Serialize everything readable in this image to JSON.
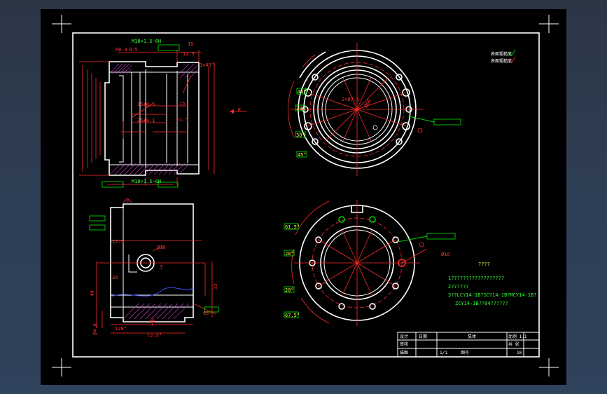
{
  "drawing": {
    "callouts": {
      "thread_top": "M18×1.5-6H",
      "thread_bottom": "M18×1.5-6H",
      "r03": "R0.3",
      "d05": "0.5",
      "d15": "15",
      "d125": "12.5",
      "chamfer": "1×45°",
      "d35": "35±0.5",
      "d25": "25±0.1",
      "d15b": "15",
      "d215": "21.5",
      "arrow_k": "K",
      "bolt": "2×Ø7.5",
      "bolt_r": "Ø66",
      "d16": "Ø16",
      "d18": "Ø18",
      "d3": "3",
      "d44": "44",
      "d33": "33",
      "d30": "30",
      "d125b": "12.5",
      "d128": "128°",
      "d725": "72.5°",
      "d6": "Ø4",
      "d65": "65°",
      "d46": "Ø4.6",
      "s1": "7"
    },
    "angles_top": [
      "45°",
      "30°",
      "30°",
      "45°"
    ],
    "angles_bottom": [
      "61.5°",
      "28°",
      "28°",
      "67.5°"
    ],
    "notes": {
      "title": "????",
      "line1": "1??????????????????",
      "line2": "2??????",
      "line3": "3??LCY14-1B?SCY14-1B?MCY14-1B?",
      "line4": "ZCY14-1B??04??????"
    },
    "legend": {
      "item1": "表面粗糙度",
      "item2": "表面粗糙度"
    },
    "title_block": {
      "c1": "设计",
      "c2": "比例 1:1",
      "c3": "审核",
      "c4": "共 张",
      "c5": "描图",
      "c6": "1/1",
      "c7": "图号",
      "c8": "10",
      "c9": "日期",
      "name": "泵体"
    }
  }
}
